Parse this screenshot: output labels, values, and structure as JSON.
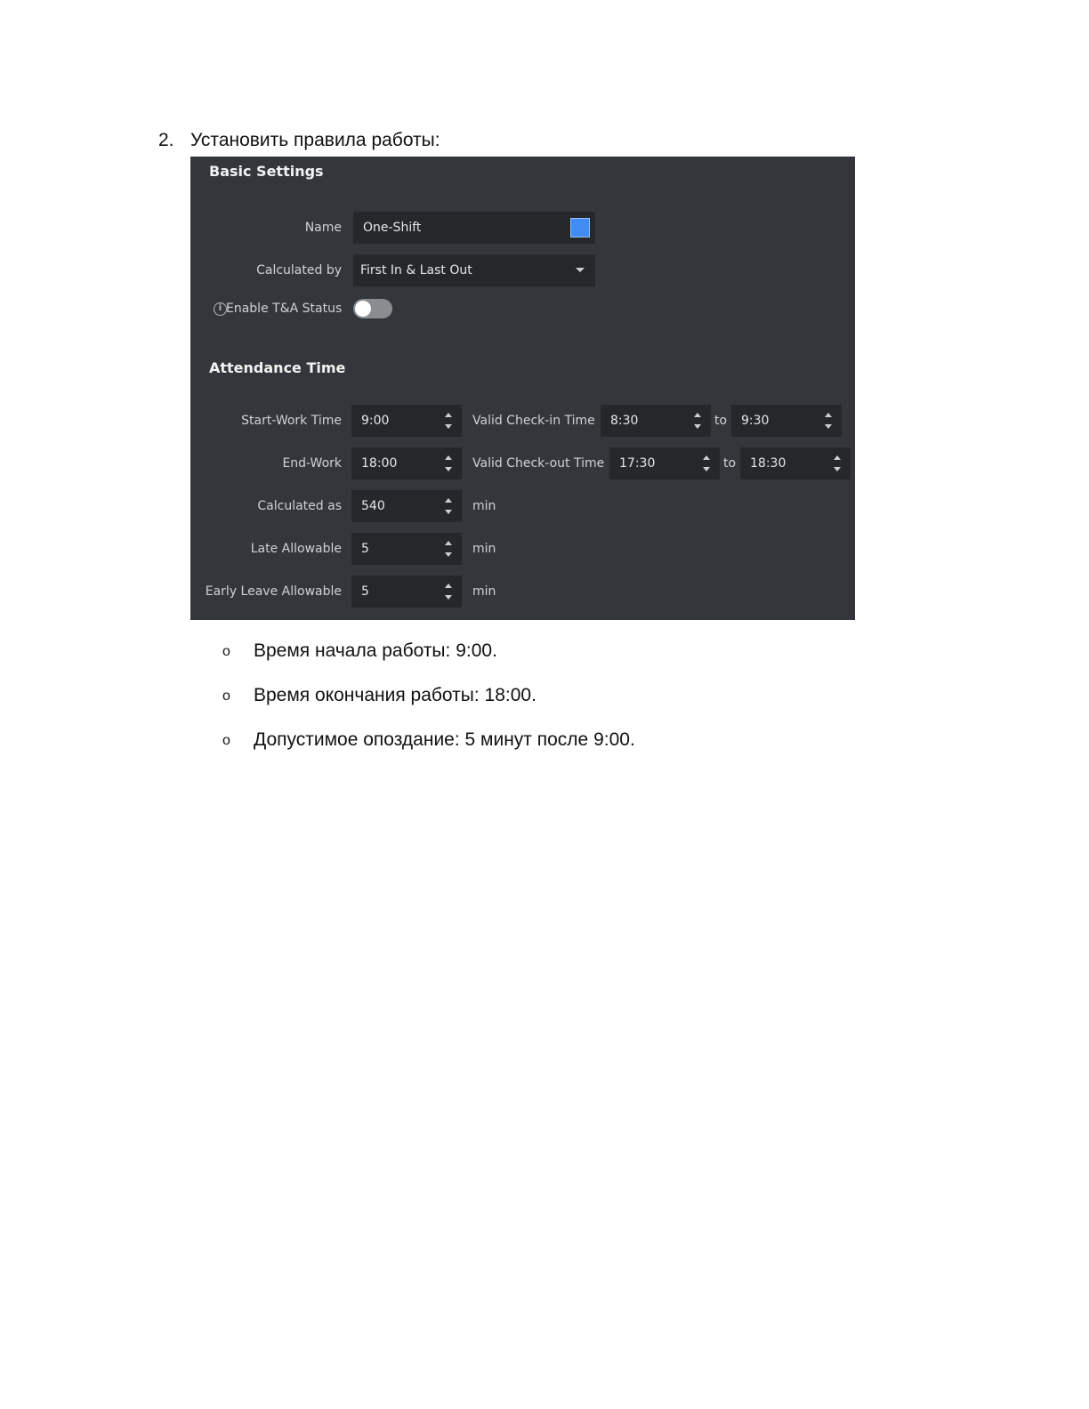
{
  "step": {
    "number": "2.",
    "text": "Установить правила работы:"
  },
  "panel": {
    "basic_settings_title": "Basic Settings",
    "name_label": "Name",
    "name_value": "One-Shift",
    "name_color": "#3f8cf5",
    "calculated_by_label": "Calculated by",
    "calculated_by_value": "First In & Last Out",
    "enable_status_label": "Enable T&A Status",
    "enable_status_on": false,
    "attendance_title": "Attendance Time",
    "start_work_label": "Start-Work Time",
    "start_work_value": "9:00",
    "valid_checkin_label": "Valid Check-in Time",
    "checkin_from": "8:30",
    "checkin_to": "9:30",
    "end_work_label": "End-Work",
    "end_work_value": "18:00",
    "valid_checkout_label": "Valid Check-out Time",
    "checkout_from": "17:30",
    "checkout_to": "18:30",
    "to_label": "to",
    "calculated_as_label": "Calculated as",
    "calculated_as_value": "540",
    "late_allowable_label": "Late Allowable",
    "late_allowable_value": "5",
    "early_leave_label": "Early Leave Allowable",
    "early_leave_value": "5",
    "unit_min": "min",
    "info_glyph": "i"
  },
  "bullets": [
    {
      "mark": "o",
      "text": "Время начала работы: 9:00."
    },
    {
      "mark": "o",
      "text": "Время окончания работы: 18:00."
    },
    {
      "mark": "o",
      "text": "Допустимое опоздание: 5 минут после 9:00."
    }
  ],
  "colors": {
    "panel_bg": "#33373b",
    "field_bg": "#25282b",
    "accent": "#3f8cf5"
  }
}
